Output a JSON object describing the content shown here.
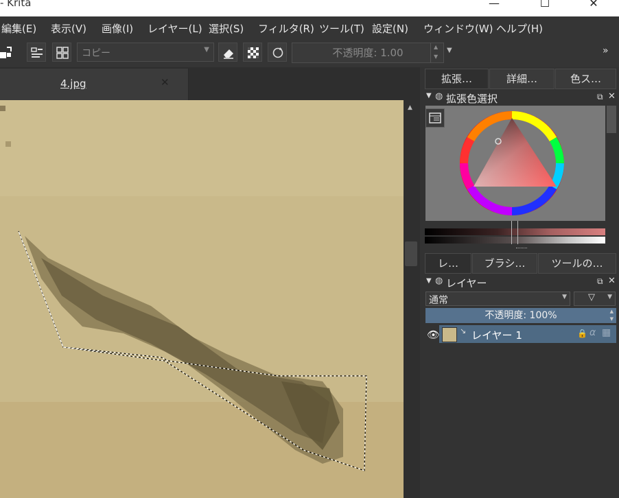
{
  "window": {
    "title": "- Krita",
    "minimize": "—",
    "maximize": "☐",
    "close": "✕"
  },
  "menu": [
    {
      "label": "編集(E)"
    },
    {
      "label": "表示(V)"
    },
    {
      "label": "画像(I)"
    },
    {
      "label": "レイヤー(L)"
    },
    {
      "label": "選択(S)"
    },
    {
      "label": "フィルタ(R)"
    },
    {
      "label": "ツール(T)"
    },
    {
      "label": "設定(N)"
    },
    {
      "label": "ウィンドウ(W)"
    },
    {
      "label": "ヘルプ(H)"
    }
  ],
  "toolbar": {
    "blend_mode": "コピー",
    "opacity": "不透明度: 1.00",
    "overflow": "»"
  },
  "document": {
    "tab_label": "4.jpg"
  },
  "dock": {
    "top_tabs": [
      {
        "label": "拡張…"
      },
      {
        "label": "詳細…"
      },
      {
        "label": "色ス…"
      }
    ],
    "color_panel_title": "拡張色選択",
    "bottom_tabs": [
      {
        "label": "レ…"
      },
      {
        "label": "ブラシ…"
      },
      {
        "label": "ツールの…"
      }
    ],
    "layers_title": "レイヤー",
    "layer_blend": "通常",
    "layer_opacity": "不透明度: 100%",
    "layers": [
      {
        "name": "レイヤー 1"
      }
    ]
  },
  "colors": {
    "accent": "#56728e",
    "layer_selected": "#4e6a84",
    "canvas_base": "#c8b889"
  }
}
